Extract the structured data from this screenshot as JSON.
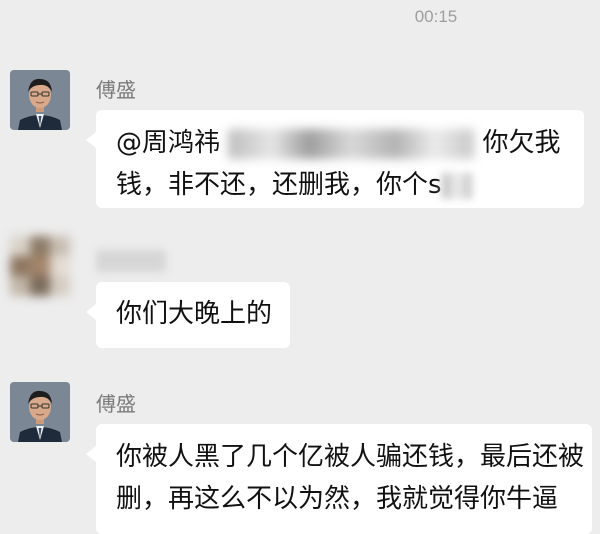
{
  "status": {
    "time": "00:15"
  },
  "messages": [
    {
      "sender": "傅盛",
      "avatar": "man-portrait-avatar",
      "text_start": "@周鸿祎 ",
      "text_after_blur": " 你欠我",
      "line2_start": "钱，非不还，还删我，你个s"
    },
    {
      "sender": "",
      "avatar": "blurred-avatar",
      "text": "你们大晚上的"
    },
    {
      "sender": "傅盛",
      "avatar": "man-portrait-avatar",
      "line1": "你被人黑了几个亿被人骗还钱，最后还被",
      "line2": "删，再这么不以为然，我就觉得你牛逼"
    }
  ],
  "colors": {
    "background": "#ededed",
    "bubble": "#ffffff",
    "sender_name": "#7b7b7b",
    "timestamp": "#9e9e9e"
  }
}
